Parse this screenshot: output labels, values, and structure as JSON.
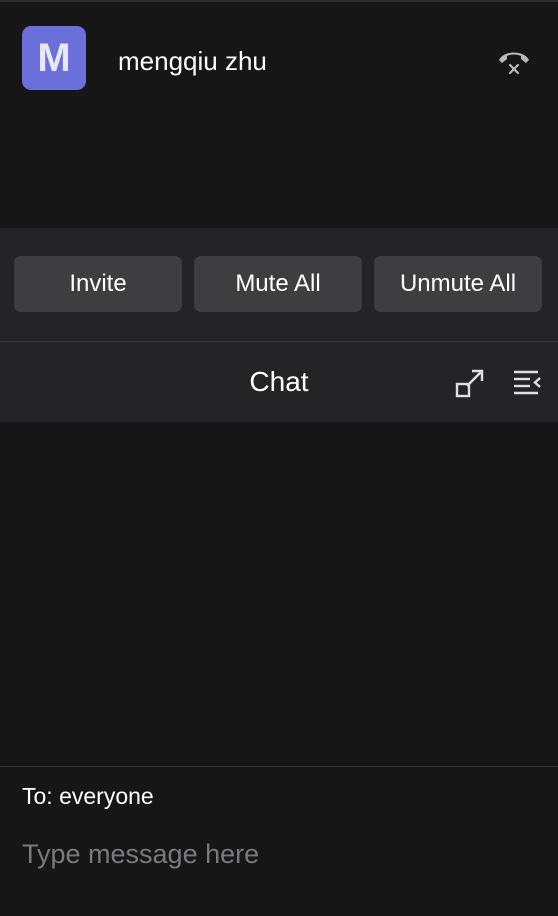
{
  "participant": {
    "avatar_letter": "M",
    "avatar_color": "#6b6fd9",
    "name": "mengqiu zhu",
    "leave_icon": "phone-hangup-icon"
  },
  "controls": {
    "invite_label": "Invite",
    "mute_all_label": "Mute All",
    "unmute_all_label": "Unmute All"
  },
  "chat": {
    "title": "Chat",
    "popout_icon": "popout-icon",
    "collapse_icon": "collapse-panel-icon",
    "to_label": "To: everyone",
    "input_placeholder": "Type message here",
    "input_value": ""
  },
  "colors": {
    "background": "#161617",
    "panel": "#242426",
    "button": "#3e3e40",
    "accent_avatar": "#6b6fd9"
  }
}
